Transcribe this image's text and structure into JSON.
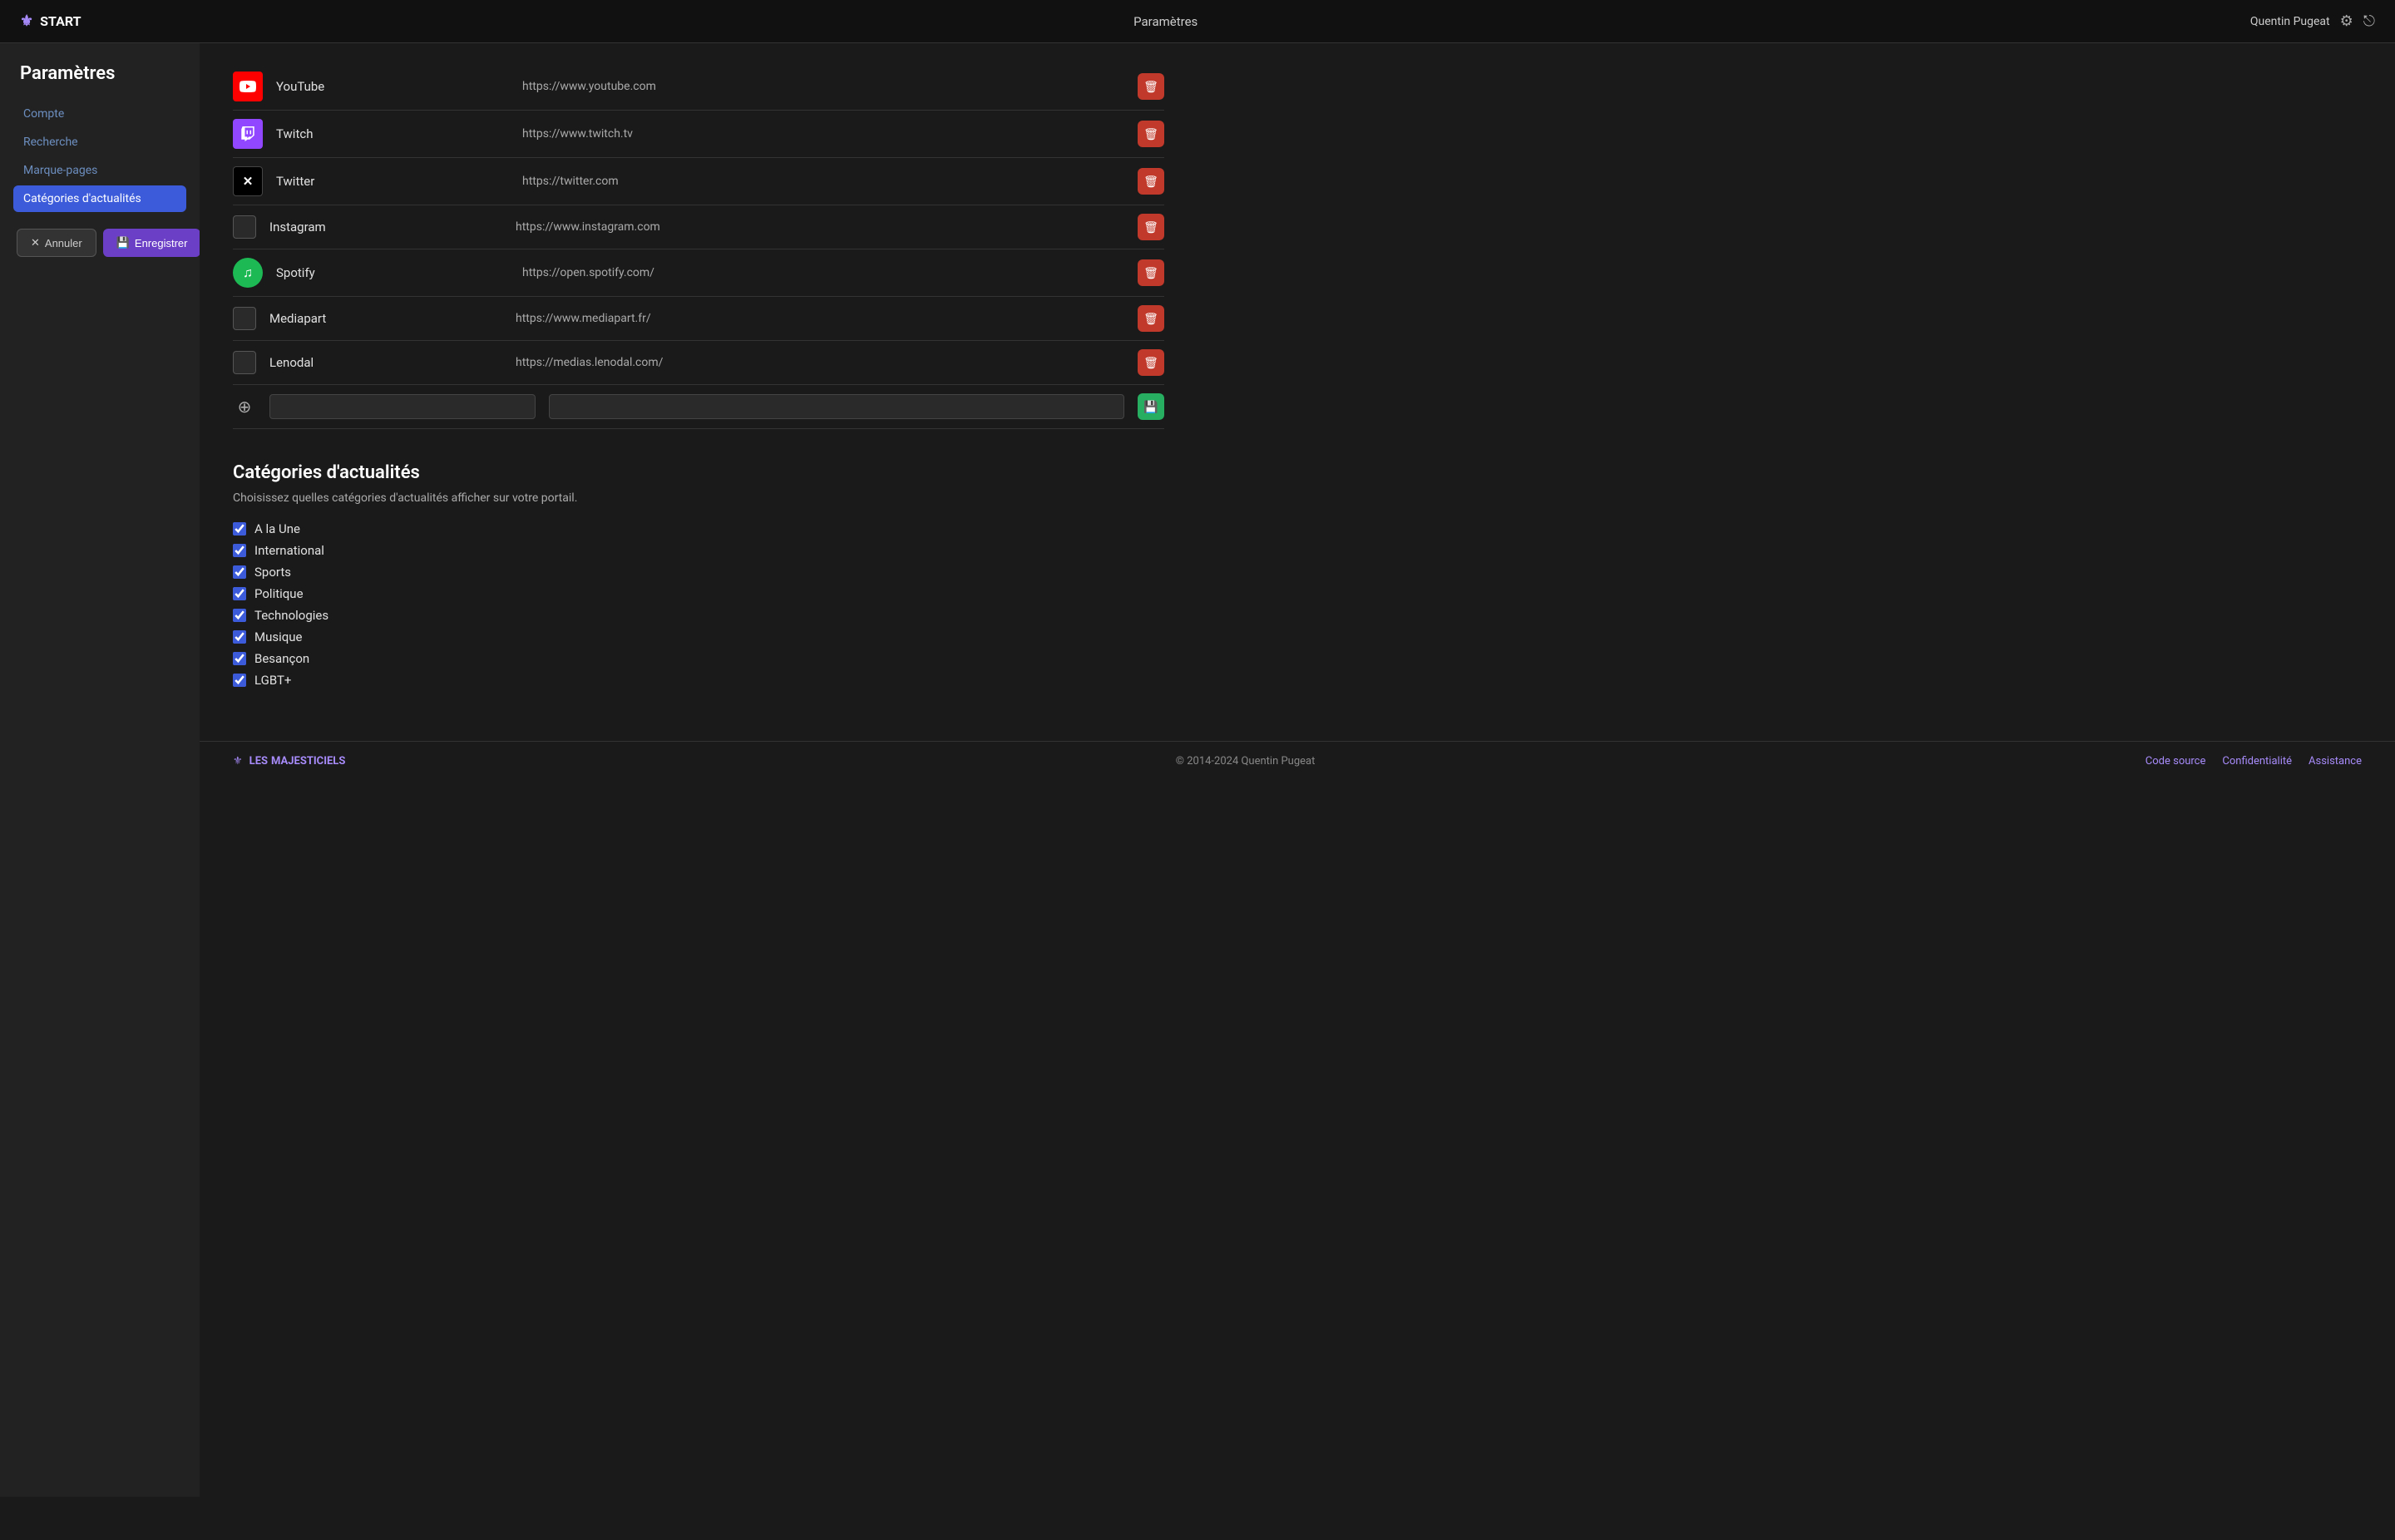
{
  "header": {
    "logo": "⚜",
    "brand": "START",
    "title": "Paramètres",
    "user": "Quentin Pugeat"
  },
  "sidebar": {
    "title": "Paramètres",
    "items": [
      {
        "label": "Compte",
        "id": "compte",
        "active": false
      },
      {
        "label": "Recherche",
        "id": "recherche",
        "active": false
      },
      {
        "label": "Marque-pages",
        "id": "marque-pages",
        "active": false
      },
      {
        "label": "Catégories d'actualités",
        "id": "categories",
        "active": true
      }
    ],
    "cancel_label": "Annuler",
    "save_label": "Enregistrer"
  },
  "services": [
    {
      "name": "YouTube",
      "url": "https://www.youtube.com",
      "icon": "▶",
      "icon_type": "youtube"
    },
    {
      "name": "Twitch",
      "url": "https://www.twitch.tv",
      "icon": "T",
      "icon_type": "twitch"
    },
    {
      "name": "Twitter",
      "url": "https://twitter.com",
      "icon": "✕",
      "icon_type": "twitter"
    },
    {
      "name": "Instagram",
      "url": "https://www.instagram.com",
      "icon": "",
      "icon_type": "empty"
    },
    {
      "name": "Spotify",
      "url": "https://open.spotify.com/",
      "icon": "♫",
      "icon_type": "spotify"
    },
    {
      "name": "Mediapart",
      "url": "https://www.mediapart.fr/",
      "icon": "",
      "icon_type": "empty"
    },
    {
      "name": "Lenodal",
      "url": "https://medias.lenodal.com/",
      "icon": "",
      "icon_type": "empty"
    }
  ],
  "new_service": {
    "name_placeholder": "",
    "url_placeholder": ""
  },
  "categories_section": {
    "title": "Catégories d'actualités",
    "description": "Choisissez quelles catégories d'actualités afficher sur votre portail.",
    "items": [
      {
        "label": "A la Une",
        "checked": true
      },
      {
        "label": "International",
        "checked": true
      },
      {
        "label": "Sports",
        "checked": true
      },
      {
        "label": "Politique",
        "checked": true
      },
      {
        "label": "Technologies",
        "checked": true
      },
      {
        "label": "Musique",
        "checked": true
      },
      {
        "label": "Besançon",
        "checked": true
      },
      {
        "label": "LGBT+",
        "checked": true
      }
    ]
  },
  "footer": {
    "les": "LES",
    "maj": "MAJESTICIELS",
    "copyright": "© 2014-2024 Quentin Pugeat",
    "links": [
      {
        "label": "Code source"
      },
      {
        "label": "Confidentialité"
      },
      {
        "label": "Assistance"
      }
    ]
  }
}
